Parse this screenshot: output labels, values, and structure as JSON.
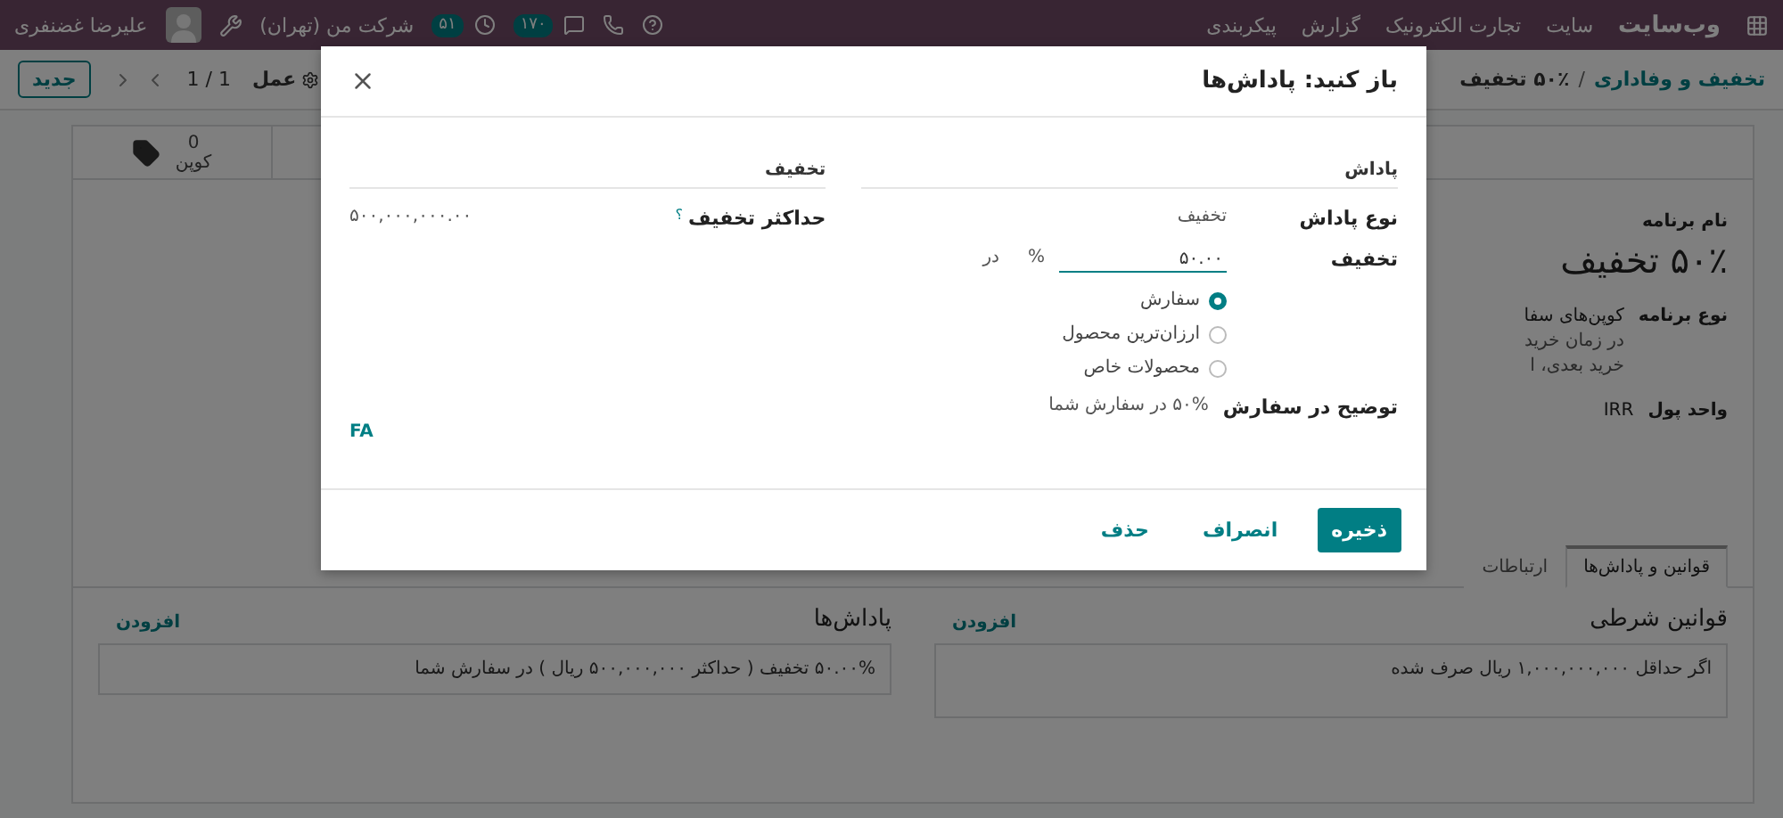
{
  "navbar": {
    "brand": "وب‌سایت",
    "menu": [
      "سایت",
      "تجارت الکترونیک",
      "گزارش",
      "پیکربندی"
    ],
    "chat_count": "۱۷۰",
    "activity_count": "۵۱",
    "company": "شرکت من (تهران)",
    "user": "علیرضا غضنفری"
  },
  "control_panel": {
    "breadcrumb": [
      "تخفیف و وفاداری",
      "۵۰٪ تخفیف"
    ],
    "separator": "/",
    "action": "عمل",
    "pager": "1 / 1",
    "new_button": "جدید"
  },
  "stat_button": {
    "value": "0",
    "label": "کوپن"
  },
  "form": {
    "title_label": "نام برنامه",
    "title": "۵۰٪ تخفیف",
    "fields": [
      {
        "label": "نوع برنامه",
        "value": "کوپن‌های سفا",
        "notes": [
          "در زمان خرید",
          "خرید بعدی، ا"
        ]
      },
      {
        "label": "واحد پول",
        "value": "IRR"
      }
    ]
  },
  "tabs": [
    {
      "label": "قوانین و پاداش‌ها",
      "selected": true
    },
    {
      "label": "ارتباطات",
      "selected": false
    }
  ],
  "sections": [
    {
      "title": "قوانین شرطی",
      "add": "افزودن",
      "items": [
        "اگر حداقل ۱,۰۰۰,۰۰۰,۰۰۰ ریال صرف شده"
      ]
    },
    {
      "title": "پاداش‌ها",
      "add": "افزودن",
      "items": [
        "۵۰.۰۰% تخفیف ( حداکثر ۵۰۰,۰۰۰,۰۰۰ ریال ) در سفارش شما"
      ]
    }
  ],
  "dialog": {
    "title": "باز کنید: پاداش‌ها",
    "reward_heading": "پاداش",
    "reward_type": {
      "label": "نوع پاداش",
      "value": "تخفیف"
    },
    "discount": {
      "label": "تخفیف",
      "value": "۵۰.۰۰",
      "unit": "%",
      "applies_label": "در",
      "options": [
        {
          "label": "سفارش",
          "selected": true
        },
        {
          "label": "ارزان‌ترین محصول",
          "selected": false
        },
        {
          "label": "محصولات خاص",
          "selected": false
        }
      ]
    },
    "description": {
      "label": "توضیح در سفارش",
      "value": "۵۰% در سفارش شما"
    },
    "discount_heading": "تخفیف",
    "max_discount": {
      "label": "حداکثر تخفیف",
      "help": "؟",
      "value": "۵۰۰,۰۰۰,۰۰۰.۰۰"
    },
    "language": "FA",
    "buttons": [
      {
        "label": "ذخیره",
        "kind": "primary"
      },
      {
        "label": "انصراف",
        "kind": "link"
      },
      {
        "label": "حذف",
        "kind": "link"
      }
    ]
  }
}
